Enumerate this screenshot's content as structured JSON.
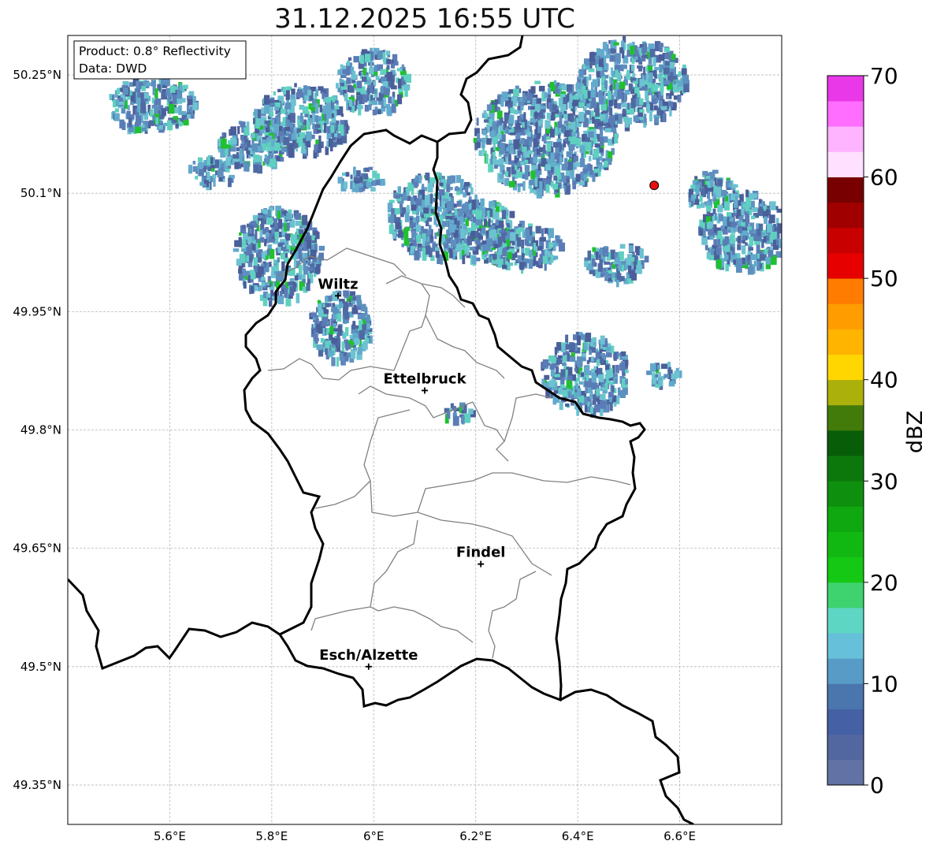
{
  "title": "31.12.2025 16:55 UTC",
  "info_box": {
    "product": "Product: 0.8° Reflectivity",
    "source": "Data: DWD"
  },
  "axes": {
    "lat_ticks": [
      "50.25°N",
      "50.1°N",
      "49.95°N",
      "49.8°N",
      "49.65°N",
      "49.5°N",
      "49.35°N"
    ],
    "lon_ticks": [
      "5.6°E",
      "5.8°E",
      "6°E",
      "6.2°E",
      "6.4°E",
      "6.6°E"
    ]
  },
  "cities": [
    {
      "name": "Wiltz",
      "lon": 5.93,
      "lat": 49.97
    },
    {
      "name": "Ettelbruck",
      "lon": 6.1,
      "lat": 49.85
    },
    {
      "name": "Findel",
      "lon": 6.21,
      "lat": 49.63
    },
    {
      "name": "Esch/Alzette",
      "lon": 5.99,
      "lat": 49.5
    }
  ],
  "radar_site": {
    "lon": 6.55,
    "lat": 50.11
  },
  "colorbar": {
    "label": "dBZ",
    "ticks": [
      "0",
      "10",
      "20",
      "30",
      "40",
      "50",
      "60",
      "70"
    ],
    "colors": [
      "#6272a4",
      "#52679f",
      "#4560a5",
      "#4a75ad",
      "#579bc6",
      "#66c0d9",
      "#5ed6c4",
      "#3ed36e",
      "#14c814",
      "#12b812",
      "#10a810",
      "#0e900e",
      "#0c780c",
      "#085e08",
      "#427b0a",
      "#acb00a",
      "#ffd600",
      "#ffb400",
      "#ff9c00",
      "#ff7c00",
      "#e60000",
      "#c80000",
      "#a00000",
      "#780000",
      "#ffe0ff",
      "#ffb4ff",
      "#ff6eff",
      "#e838e8"
    ]
  },
  "colors": {
    "border": "#000000",
    "cantons": "#808080",
    "grid": "#b8b8b8"
  }
}
